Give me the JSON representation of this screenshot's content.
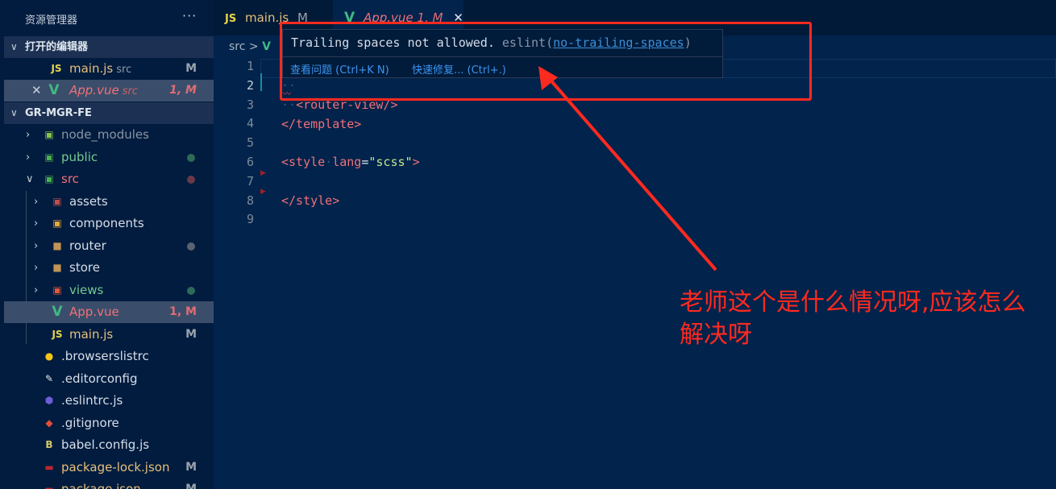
{
  "sidebar": {
    "title": "资源管理器",
    "more": "···",
    "open_editors": {
      "label": "打开的编辑器",
      "items": [
        {
          "icon": "JS",
          "name": "main.js",
          "dir": "src",
          "badge": "M"
        },
        {
          "icon": "V",
          "name": "App.vue",
          "dir": "src",
          "badge": "1, M"
        }
      ]
    },
    "project": {
      "label": "GR-MGR-FE",
      "items": [
        {
          "name": "node_modules",
          "color": "#8a95a3",
          "dot": ""
        },
        {
          "name": "public",
          "color": "#73c991",
          "dot": "#2d6a58"
        },
        {
          "name": "src",
          "color": "#f07178",
          "dot": "#6a3a4a"
        },
        {
          "name": "assets",
          "color": "#d6dee8",
          "dot": ""
        },
        {
          "name": "components",
          "color": "#d6dee8",
          "dot": ""
        },
        {
          "name": "router",
          "color": "#d6dee8",
          "dot": "#5a6270"
        },
        {
          "name": "store",
          "color": "#d6dee8",
          "dot": ""
        },
        {
          "name": "views",
          "color": "#73c991",
          "dot": "#2d6a58"
        },
        {
          "name": "App.vue",
          "color": "#f07178",
          "badge": "1, M"
        },
        {
          "name": "main.js",
          "color": "#e5c07b",
          "badge": "M"
        },
        {
          "name": ".browserslistrc",
          "color": "#d6dee8"
        },
        {
          "name": ".editorconfig",
          "color": "#d6dee8"
        },
        {
          "name": ".eslintrc.js",
          "color": "#d6dee8"
        },
        {
          "name": ".gitignore",
          "color": "#d6dee8"
        },
        {
          "name": "babel.config.js",
          "color": "#d6dee8"
        },
        {
          "name": "package-lock.json",
          "color": "#e5c07b",
          "badge": "M"
        },
        {
          "name": "package.json",
          "color": "#e5c07b",
          "badge": "M"
        }
      ]
    }
  },
  "tabs": [
    {
      "icon": "JS",
      "name": "main.js",
      "badge": "M"
    },
    {
      "icon": "V",
      "name": "App.vue",
      "badge": "1, M",
      "close": "✕"
    }
  ],
  "breadcrumb": {
    "folder": "src",
    "sep": ">"
  },
  "lines": [
    "1",
    "2",
    "3",
    "4",
    "5",
    "6",
    "7",
    "8",
    "9"
  ],
  "code": {
    "l2": "··",
    "l3_ws": "··",
    "l3": "<router-view/>",
    "l4": "</template>",
    "l6a": "<style",
    "l6b": "lang",
    "l6c": "=",
    "l6d": "\"scss\"",
    "l6e": ">",
    "l8": "</style>"
  },
  "hover": {
    "message": "Trailing spaces not allowed.",
    "source": "eslint(",
    "rule": "no-trailing-spaces",
    "close_paren": ")",
    "action1": "查看问题 (Ctrl+K N)",
    "action2": "快速修复... (Ctrl+.)"
  },
  "annotation": {
    "text": "老师这个是什么情况呀,应该怎么解决呀",
    "color": "#ff2a1f"
  }
}
